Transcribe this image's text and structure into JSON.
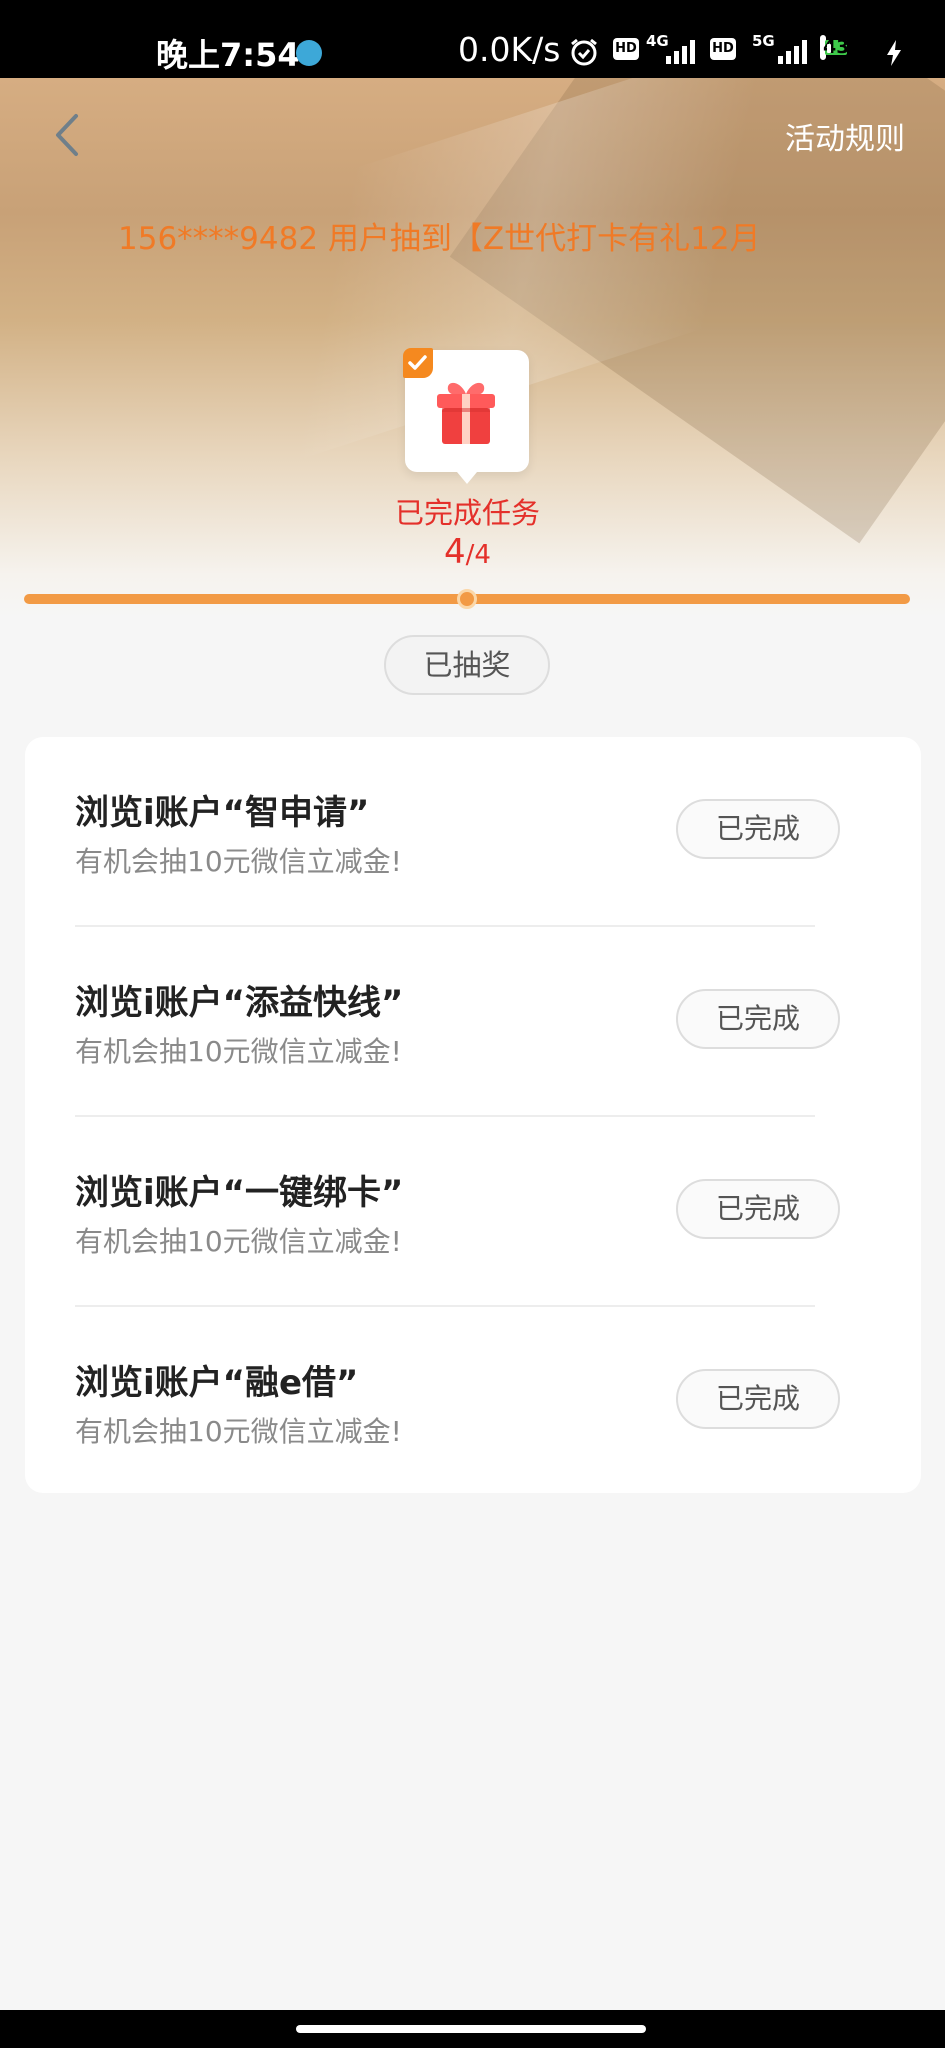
{
  "status_bar": {
    "time": "晚上7:54",
    "speed": "0.0K/s",
    "net1": "4G",
    "net2": "5G",
    "battery": "43",
    "hd": "HD"
  },
  "header": {
    "rules_label": "活动规则",
    "ticker": "156****9482 用户抽到【Z世代打卡有礼12月"
  },
  "progress": {
    "label": "已完成任务",
    "done": "4",
    "total": "/4",
    "fraction": 1.0
  },
  "draw_button": "已抽奖",
  "tasks": [
    {
      "title": "浏览i账户“智申请”",
      "desc": "有机会抽10元微信立减金!",
      "status": "已完成"
    },
    {
      "title": "浏览i账户“添益快线”",
      "desc": "有机会抽10元微信立减金!",
      "status": "已完成"
    },
    {
      "title": "浏览i账户“一键绑卡”",
      "desc": "有机会抽10元微信立减金!",
      "status": "已完成"
    },
    {
      "title": "浏览i账户“融e借”",
      "desc": "有机会抽10元微信立减金!",
      "status": "已完成"
    }
  ],
  "icons": {
    "back": "chevron-left-icon",
    "gift": "gift-icon",
    "check": "check-icon",
    "alarm": "alarm-icon"
  },
  "colors": {
    "accent": "#f29a45",
    "ticker": "#f07a26",
    "highlight_red": "#e4302a"
  }
}
